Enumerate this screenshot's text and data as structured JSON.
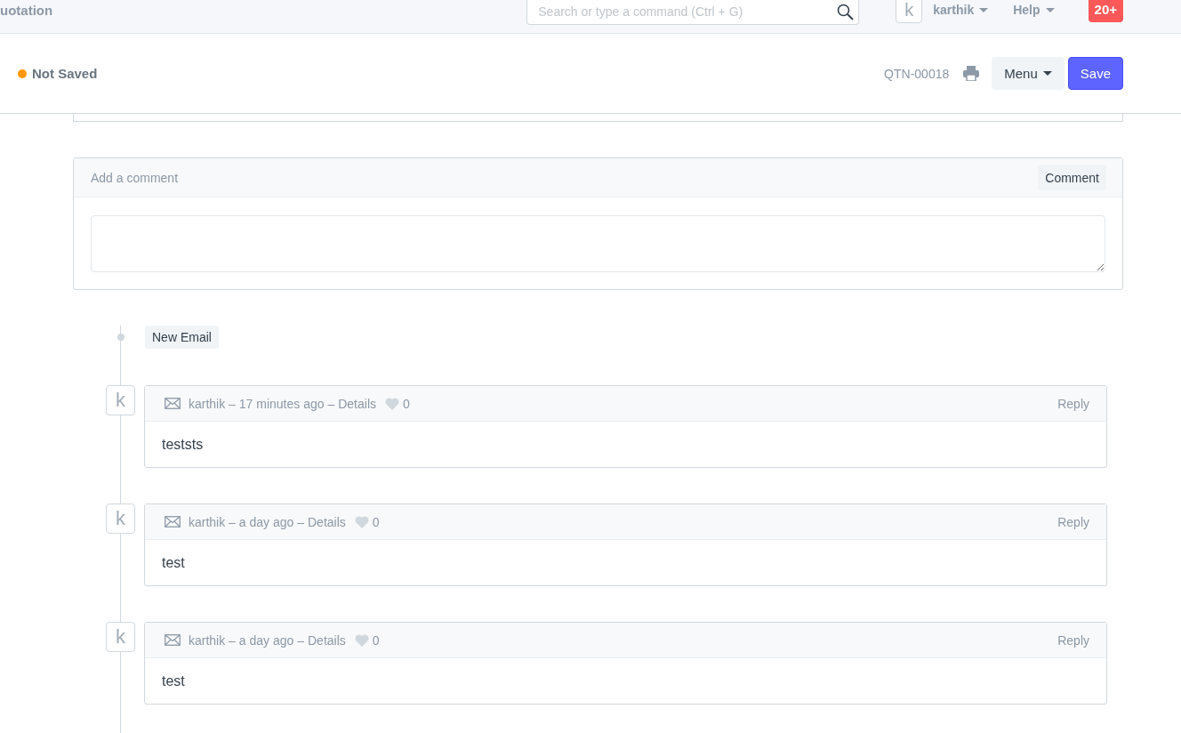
{
  "navbar": {
    "title": "uotation",
    "search": {
      "placeholder": "Search or type a command (Ctrl + G)"
    },
    "avatar": "k",
    "user": "karthik",
    "help": "Help",
    "notifications": "20+"
  },
  "page_header": {
    "status": "Not Saved",
    "saved": false,
    "doc_name": "QTN-00018",
    "menu": "Menu",
    "save": "Save"
  },
  "comment_box": {
    "placeholder": "Add a comment",
    "button": "Comment"
  },
  "timeline": {
    "new_email": "New Email",
    "items": [
      {
        "avatar": "k",
        "meta": "karthik – 17 minutes ago –",
        "details": "Details",
        "likes": "0",
        "reply": "Reply",
        "body": "teststs"
      },
      {
        "avatar": "k",
        "meta": "karthik – a day ago –",
        "details": "Details",
        "likes": "0",
        "reply": "Reply",
        "body": "test"
      },
      {
        "avatar": "k",
        "meta": "karthik – a day ago –",
        "details": "Details",
        "likes": "0",
        "reply": "Reply",
        "body": "test"
      }
    ]
  }
}
